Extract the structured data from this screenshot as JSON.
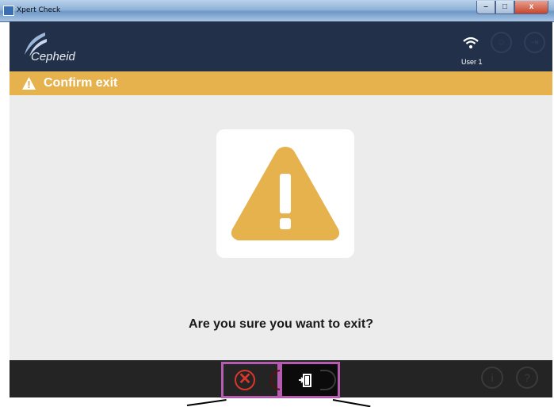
{
  "window": {
    "title": "Xpert Check",
    "controls": [
      "–",
      "□",
      "x"
    ]
  },
  "header": {
    "logo_text": "Cepheid",
    "user_label": "User 1",
    "icons": [
      "wifi-icon",
      "user-icon",
      "exit-icon"
    ]
  },
  "banner": {
    "title": "Confirm exit",
    "icon": "warning-icon"
  },
  "dialog": {
    "question": "Are you sure you want to exit?",
    "illustration": "warning-triangle-icon",
    "accent_color": "#e6b24e"
  },
  "footer": {
    "cancel_symbol": "✕",
    "cancel_icon": "close-icon",
    "exit_icon": "exit-door-icon",
    "right_icons": [
      "info-icon",
      "help-icon"
    ],
    "info_glyph": "i",
    "help_glyph": "?"
  },
  "colors": {
    "header_bg": "#223049",
    "banner_bg": "#e6b24e",
    "highlight": "#b55bb0",
    "cancel_red": "#d9362c"
  }
}
